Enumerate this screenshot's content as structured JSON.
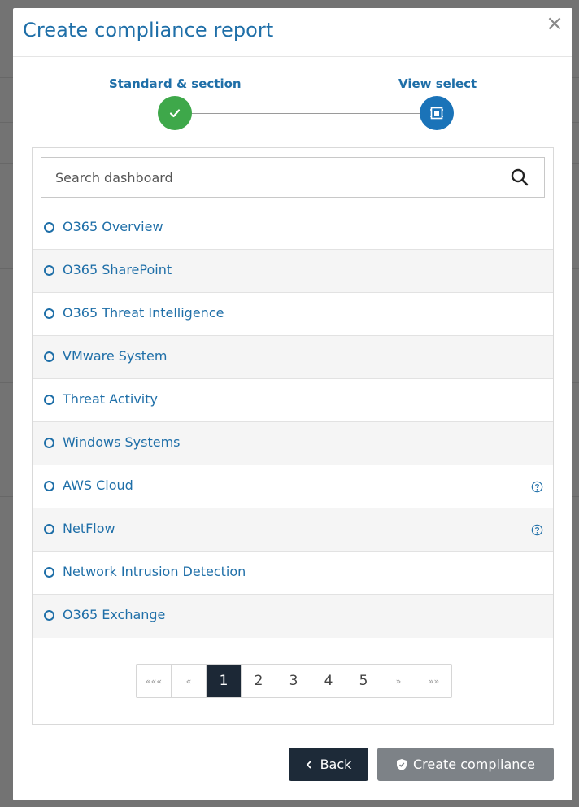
{
  "modal": {
    "title": "Create compliance report",
    "close_glyph": "×"
  },
  "stepper": {
    "steps": [
      {
        "label": "Standard & section",
        "state": "completed",
        "icon": "check-icon"
      },
      {
        "label": "View select",
        "state": "current",
        "icon": "view-select-icon"
      }
    ],
    "colors": {
      "completed": "#3ea84a",
      "current": "#1a73b8"
    }
  },
  "search": {
    "placeholder": "Search dashboard",
    "value": "",
    "icon": "search-icon"
  },
  "dashboards": [
    {
      "label": "O365 Overview",
      "help": false
    },
    {
      "label": "O365 SharePoint",
      "help": false
    },
    {
      "label": "O365 Threat Intelligence",
      "help": false
    },
    {
      "label": "VMware System",
      "help": false
    },
    {
      "label": "Threat Activity",
      "help": false
    },
    {
      "label": "Windows Systems",
      "help": false
    },
    {
      "label": "AWS Cloud",
      "help": true
    },
    {
      "label": "NetFlow",
      "help": true
    },
    {
      "label": "Network Intrusion Detection",
      "help": false
    },
    {
      "label": "O365 Exchange",
      "help": false
    }
  ],
  "pagination": {
    "first": "«««",
    "prev": "«",
    "pages": [
      "1",
      "2",
      "3",
      "4",
      "5"
    ],
    "current": "1",
    "next": "»",
    "last": "»»"
  },
  "footer": {
    "back_label": "Back",
    "back_icon": "chevron-left-icon",
    "create_label": "Create compliance",
    "create_icon": "shield-icon"
  },
  "colors": {
    "accent": "#1f6fa8",
    "dark_button": "#1d2a38",
    "disabled_button": "#7d8287"
  }
}
